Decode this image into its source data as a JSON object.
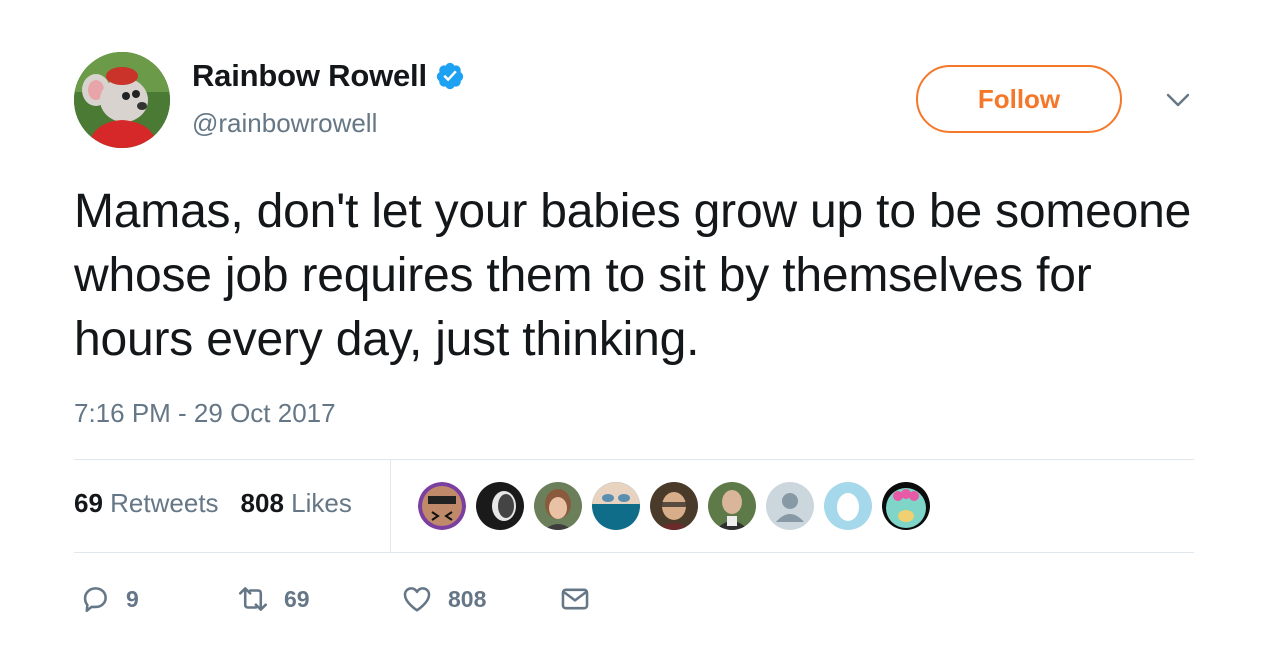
{
  "user": {
    "display_name": "Rainbow Rowell",
    "handle": "@rainbowrowell",
    "verified": true
  },
  "follow_label": "Follow",
  "tweet": {
    "text": "Mamas, don't let your babies grow up to be someone whose job requires them to sit by themselves for hours every day, just thinking.",
    "timestamp": "7:16 PM - 29 Oct 2017"
  },
  "stats": {
    "retweets_count": "69",
    "retweets_label": "Retweets",
    "likes_count": "808",
    "likes_label": "Likes"
  },
  "actions": {
    "reply_count": "9",
    "retweet_count": "69",
    "like_count": "808"
  },
  "colors": {
    "accent": "#f5772a",
    "verified": "#1da1f2",
    "muted": "#657786",
    "divider": "#e1e8ed"
  },
  "icons": [
    "verified-badge-icon",
    "chevron-down-icon",
    "reply-icon",
    "retweet-icon",
    "heart-icon",
    "envelope-icon"
  ]
}
